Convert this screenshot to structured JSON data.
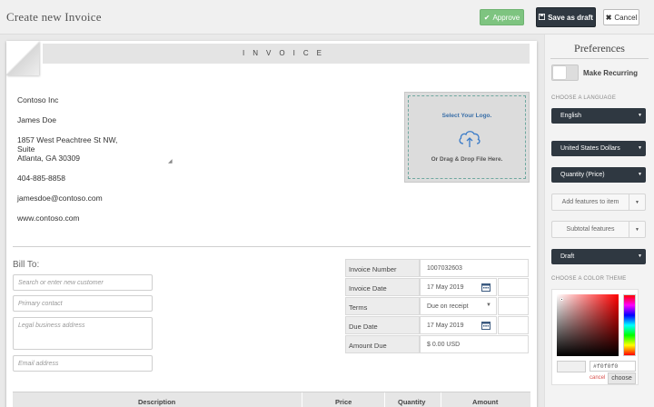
{
  "topbar": {
    "title": "Create new Invoice",
    "approve_label": "Approve",
    "draft_label": "Save as draft",
    "cancel_label": "Cancel"
  },
  "invoice": {
    "header": "INVOICE",
    "company": {
      "name": "Contoso Inc",
      "contact": "James Doe",
      "address_line1": "1857 West Peachtree St NW,",
      "address_line2": "Suite",
      "address_line3": "Atlanta, GA 30309",
      "phone": "404-885-8858",
      "email": "jamesdoe@contoso.com",
      "website": "www.contoso.com"
    },
    "logo": {
      "title": "Select Your Logo.",
      "subtitle": "Or Drag & Drop File Here."
    },
    "bill_to": {
      "label": "Bill To:",
      "customer_placeholder": "Search or enter new customer",
      "contact_placeholder": "Primary contact",
      "address_placeholder": "Legal business address",
      "email_placeholder": "Email address"
    },
    "meta": {
      "number_label": "Invoice Number",
      "number_value": "1007032603",
      "date_label": "Invoice Date",
      "date_value": "17 May 2019",
      "terms_label": "Terms",
      "terms_value": "Due on receipt",
      "due_label": "Due Date",
      "due_value": "17 May 2019",
      "amount_label": "Amount Due",
      "amount_value": "$  0.00 USD"
    },
    "table": {
      "columns": [
        "Description",
        "Price",
        "Quantity",
        "Amount"
      ]
    }
  },
  "sidebar": {
    "title": "Preferences",
    "recurring_label": "Make Recurring",
    "language_section": "CHOOSE A LANGUAGE",
    "language_value": "English",
    "currency_value": "United States Dollars",
    "quantity_value": "Quantity (Price)",
    "add_features_label": "Add features to item",
    "subtotal_label": "Subtotal features",
    "status_value": "Draft",
    "color_section": "CHOOSE A COLOR THEME",
    "color_hex": "#f0f0f0",
    "picker_cancel": "cancel",
    "picker_choose": "choose"
  },
  "colors": {
    "approve": "#7ec480",
    "dark": "#2f3841",
    "logo_text": "#3a6fa8"
  }
}
